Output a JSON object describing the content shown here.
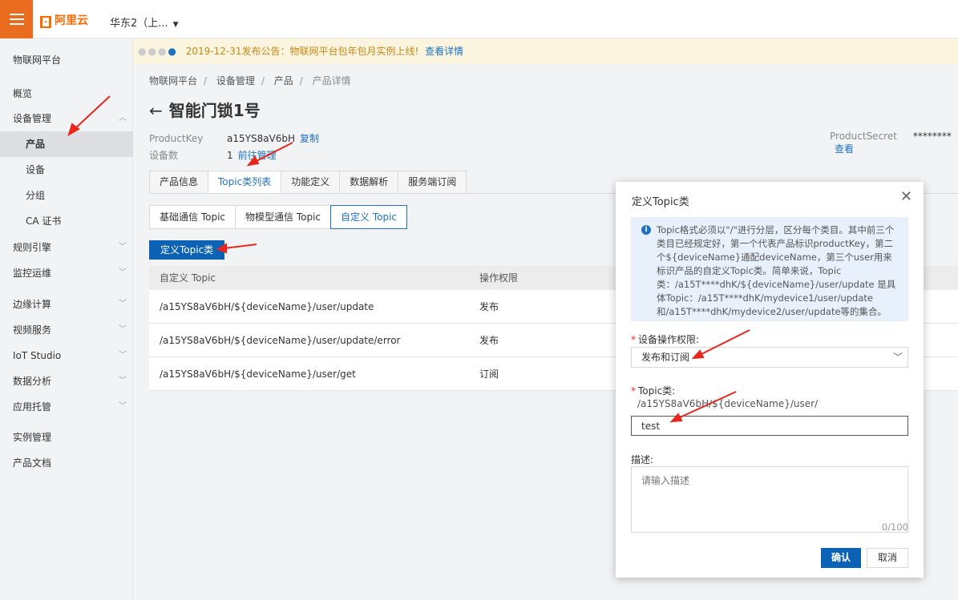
{
  "topbar": {
    "brand": "阿里云",
    "region": "华东2（上..."
  },
  "notice": {
    "text": "2019-12-31发布公告：物联网平台包年包月实例上线!",
    "link": "查看详情"
  },
  "sidebar": {
    "title": "物联网平台",
    "items": [
      {
        "label": "概览"
      },
      {
        "label": "设备管理"
      },
      {
        "label": "产品"
      },
      {
        "label": "设备"
      },
      {
        "label": "分组"
      },
      {
        "label": "CA 证书"
      },
      {
        "label": "规则引擎"
      },
      {
        "label": "监控运维"
      },
      {
        "label": "边缘计算"
      },
      {
        "label": "视频服务"
      },
      {
        "label": "IoT Studio"
      },
      {
        "label": "数据分析"
      },
      {
        "label": "应用托管"
      },
      {
        "label": "实例管理"
      },
      {
        "label": "产品文档"
      }
    ]
  },
  "breadcrumb": {
    "items": [
      "物联网平台",
      "设备管理",
      "产品",
      "产品详情"
    ]
  },
  "page": {
    "title": "智能门锁1号",
    "product_key_label": "ProductKey",
    "product_key_value": "a15YS8aV6bH",
    "copy_label": "复制",
    "device_count_label": "设备数",
    "device_count_value": "1",
    "manage_link": "前往管理",
    "product_secret_label": "ProductSecret",
    "product_secret_value": "********",
    "view_link": "查看"
  },
  "tabs": [
    "产品信息",
    "Topic类列表",
    "功能定义",
    "数据解析",
    "服务端订阅"
  ],
  "subtabs": [
    "基础通信 Topic",
    "物模型通信 Topic",
    "自定义 Topic"
  ],
  "define_button": "定义Topic类",
  "table": {
    "headers": [
      "自定义 Topic",
      "操作权限"
    ],
    "rows": [
      {
        "topic": "/a15YS8aV6bH/${deviceName}/user/update",
        "perm": "发布"
      },
      {
        "topic": "/a15YS8aV6bH/${deviceName}/user/update/error",
        "perm": "发布"
      },
      {
        "topic": "/a15YS8aV6bH/${deviceName}/user/get",
        "perm": "订阅"
      }
    ]
  },
  "dialog": {
    "title": "定义Topic类",
    "tip": "Topic格式必须以\"/\"进行分层，区分每个类目。其中前三个类目已经规定好，第一个代表产品标识productKey，第二个${deviceName}通配deviceName，第三个user用来标识产品的自定义Topic类。简单来说，Topic类：/a15T****dhK/${deviceName}/user/update 是具体Topic：/a15T****dhK/mydevice1/user/update和/a15T****dhK/mydevice2/user/update等的集合。",
    "permission_label": "设备操作权限:",
    "permission_value": "发布和订阅",
    "topic_label": "Topic类:",
    "topic_prefix": "/a15YS8aV6bH/${deviceName}/user/",
    "topic_value": "test",
    "desc_label": "描述:",
    "desc_placeholder": "请输入描述",
    "counter": "0/100",
    "ok": "确认",
    "cancel": "取消"
  }
}
